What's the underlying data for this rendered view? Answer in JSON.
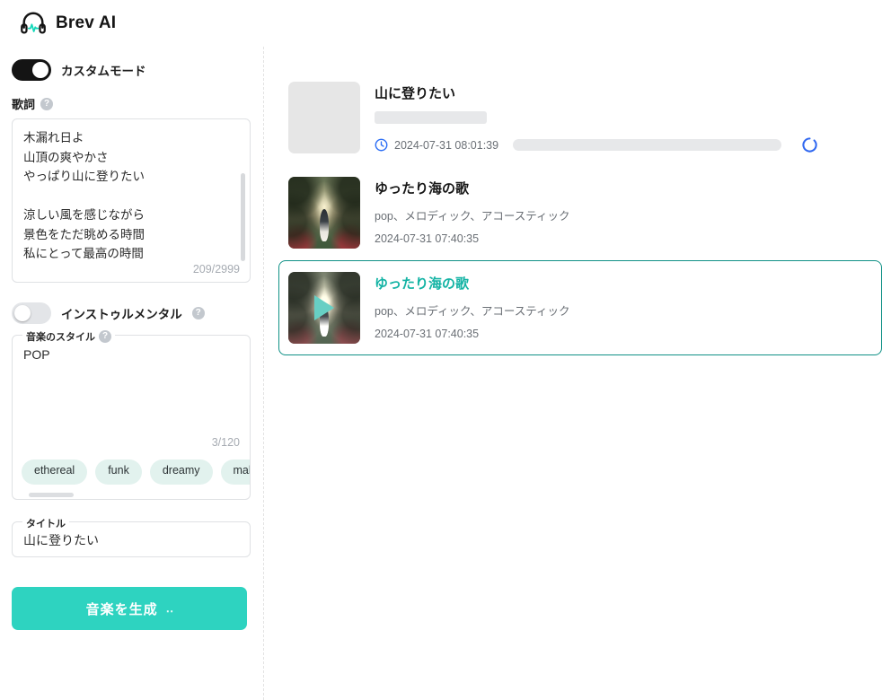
{
  "header": {
    "app_title": "Brev AI",
    "logo_icon": "headphone-waveform-icon"
  },
  "sidebar": {
    "custom_mode": {
      "label": "カスタムモード",
      "state": "on"
    },
    "lyrics": {
      "label": "歌詞",
      "help_glyph": "?",
      "value": "木漏れ日よ\n山頂の爽やかさ\nやっぱり山に登りたい\n\n涼しい風を感じながら\n景色をただ眺める時間\n私にとって最高の時間\n山に登りたい",
      "counter": "209/2999"
    },
    "instrumental": {
      "label": "インストゥルメンタル",
      "state": "off",
      "help_glyph": "?"
    },
    "style": {
      "label": "音楽のスタイル",
      "help_glyph": "?",
      "value": "POP",
      "counter": "3/120",
      "tags": [
        "ethereal",
        "funk",
        "dreamy",
        "male vocal"
      ]
    },
    "title_field": {
      "label": "タイトル",
      "value": "山に登りたい"
    },
    "generate_button": {
      "label": "音楽を生成",
      "dots": "‥"
    }
  },
  "main": {
    "tracks": [
      {
        "title": "山に登りたい",
        "tags": "",
        "date": "2024-07-31 08:01:39",
        "state": "loading",
        "selected": false,
        "thumb": "placeholder",
        "status_icon": "clock-icon",
        "spinner_icon": "loading-spinner-icon"
      },
      {
        "title": "ゆったり海の歌",
        "tags": "pop、メロディック、アコースティック",
        "date": "2024-07-31 07:40:35",
        "state": "ready",
        "selected": false,
        "thumb": "forest-artwork"
      },
      {
        "title": "ゆったり海の歌",
        "tags": "pop、メロディック、アコースティック",
        "date": "2024-07-31 07:40:35",
        "state": "playing",
        "selected": true,
        "thumb": "forest-artwork",
        "play_icon": "play-triangle-icon"
      }
    ]
  },
  "colors": {
    "accent_teal": "#2ed3c0",
    "selected_border": "#109186",
    "tag_bg": "#e2f2ee",
    "status_blue": "#2c6ef5"
  }
}
